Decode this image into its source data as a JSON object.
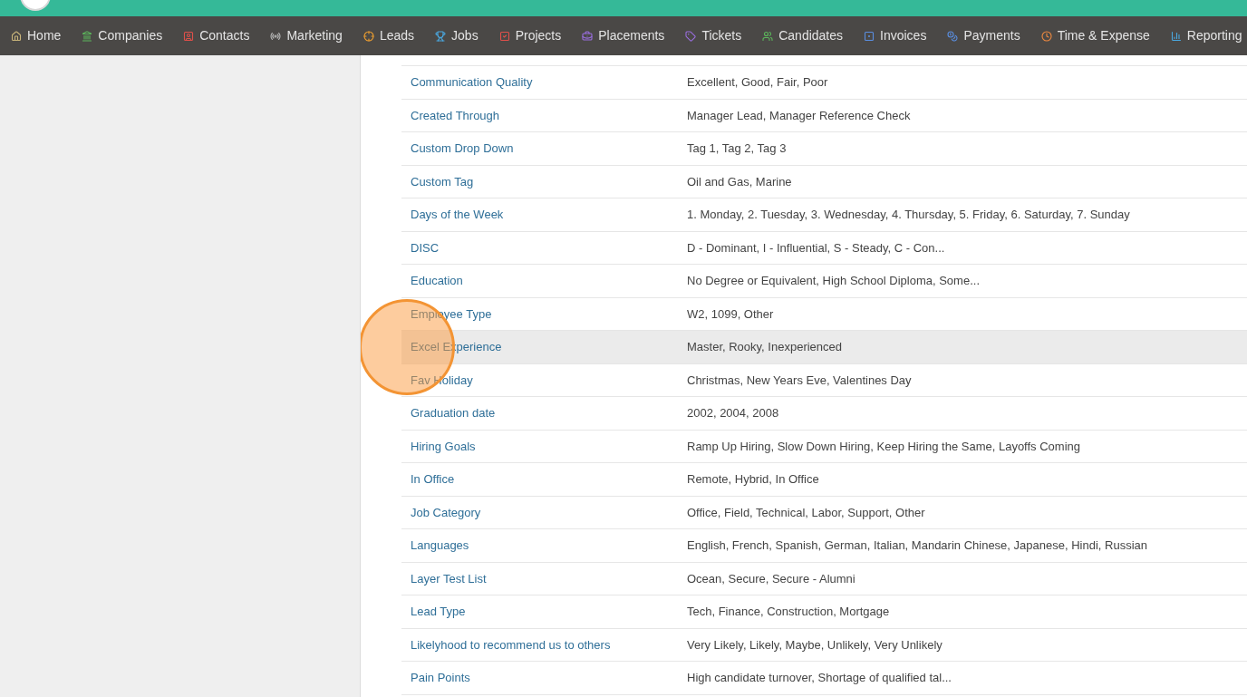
{
  "nav": [
    {
      "label": "Home"
    },
    {
      "label": "Companies"
    },
    {
      "label": "Contacts"
    },
    {
      "label": "Marketing"
    },
    {
      "label": "Leads"
    },
    {
      "label": "Jobs"
    },
    {
      "label": "Projects"
    },
    {
      "label": "Placements"
    },
    {
      "label": "Tickets"
    },
    {
      "label": "Candidates"
    },
    {
      "label": "Invoices"
    },
    {
      "label": "Payments"
    },
    {
      "label": "Time & Expense"
    },
    {
      "label": "Reporting"
    }
  ],
  "rows": [
    {
      "name": "Communication Quality",
      "values": "Excellent, Good, Fair, Poor",
      "highlighted": false
    },
    {
      "name": "Created Through",
      "values": "Manager Lead, Manager Reference Check",
      "highlighted": false
    },
    {
      "name": "Custom Drop Down",
      "values": "Tag 1, Tag 2, Tag 3",
      "highlighted": false
    },
    {
      "name": "Custom Tag",
      "values": "Oil and Gas, Marine",
      "highlighted": false
    },
    {
      "name": "Days of the Week",
      "values": "1. Monday, 2. Tuesday, 3. Wednesday, 4. Thursday, 5. Friday, 6. Saturday, 7. Sunday",
      "highlighted": false
    },
    {
      "name": "DISC",
      "values": "D - Dominant, I - Influential, S - Steady, C - Con...",
      "highlighted": false
    },
    {
      "name": "Education",
      "values": "No Degree or Equivalent, High School Diploma, Some...",
      "highlighted": false
    },
    {
      "name": "Employee Type",
      "values": "W2, 1099, Other",
      "highlighted": false
    },
    {
      "name": "Excel Experience",
      "values": "Master, Rooky, Inexperienced",
      "highlighted": true,
      "clicked": true
    },
    {
      "name": "Fav Holiday",
      "values": "Christmas, New Years Eve, Valentines Day",
      "highlighted": false
    },
    {
      "name": "Graduation date",
      "values": "2002, 2004, 2008",
      "highlighted": false
    },
    {
      "name": "Hiring Goals",
      "values": "Ramp Up Hiring, Slow Down Hiring, Keep Hiring the Same, Layoffs Coming",
      "highlighted": false
    },
    {
      "name": "In Office",
      "values": "Remote, Hybrid, In Office",
      "highlighted": false
    },
    {
      "name": "Job Category",
      "values": "Office, Field, Technical, Labor, Support, Other",
      "highlighted": false
    },
    {
      "name": "Languages",
      "values": "English, French, Spanish, German, Italian, Mandarin Chinese, Japanese, Hindi, Russian",
      "highlighted": false
    },
    {
      "name": "Layer Test List",
      "values": "Ocean, Secure, Secure - Alumni",
      "highlighted": false
    },
    {
      "name": "Lead Type",
      "values": "Tech, Finance, Construction, Mortgage",
      "highlighted": false
    },
    {
      "name": "Likelyhood to recommend us to others",
      "values": "Very Likely, Likely, Maybe, Unlikely, Very Unlikely",
      "highlighted": false
    },
    {
      "name": "Pain Points",
      "values": "High candidate turnover, Shortage of qualified tal...",
      "highlighted": false
    }
  ]
}
